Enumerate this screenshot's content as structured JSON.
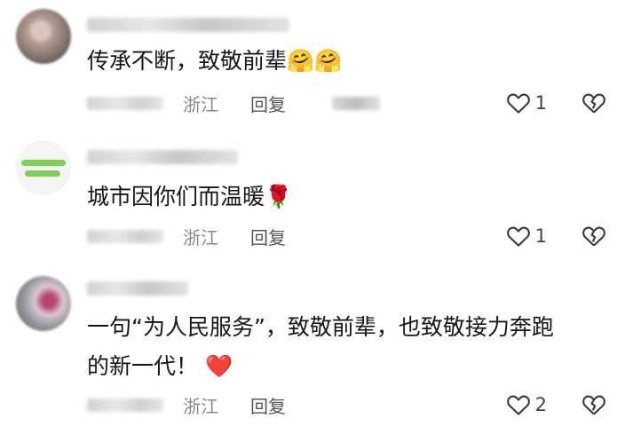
{
  "comments": [
    {
      "text": "传承不断，致敬前辈",
      "emoji": "🤗🤗",
      "location": "浙江",
      "reply_label": "回复",
      "like_count": "1"
    },
    {
      "text": "城市因你们而温暖",
      "emoji": "🌹",
      "location": "浙江",
      "reply_label": "回复",
      "like_count": "1"
    },
    {
      "text_line1": "一句“为人民服务”，致敬前辈，也致敬接力奔跑",
      "text_line2": "的新一代！",
      "emoji": "❤️",
      "location": "浙江",
      "reply_label": "回复",
      "like_count": "2"
    }
  ],
  "icons": {
    "like": "heart-outline-icon",
    "dislike": "broken-heart-icon"
  },
  "colors": {
    "text": "#161616",
    "meta": "#8a8a8a",
    "reply": "#555555",
    "icon": "#444444",
    "heart_emoji": "#e02b3c"
  }
}
